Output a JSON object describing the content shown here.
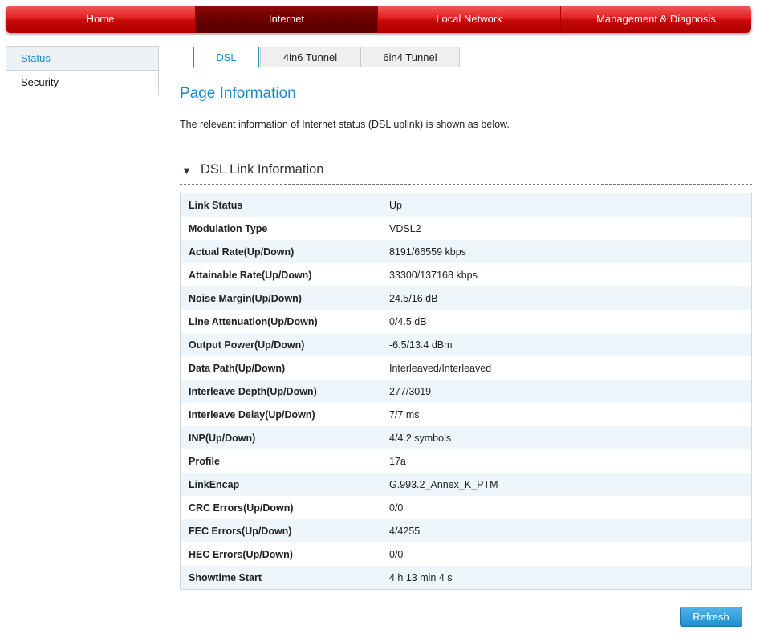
{
  "topnav": {
    "tabs": [
      {
        "label": "Home"
      },
      {
        "label": "Internet"
      },
      {
        "label": "Local Network"
      },
      {
        "label": "Management & Diagnosis"
      }
    ],
    "active": "Internet"
  },
  "sidebar": {
    "items": [
      {
        "label": "Status"
      },
      {
        "label": "Security"
      }
    ],
    "active": "Status"
  },
  "subtabs": {
    "items": [
      {
        "label": "DSL"
      },
      {
        "label": "4in6 Tunnel"
      },
      {
        "label": "6in4 Tunnel"
      }
    ],
    "active": "DSL"
  },
  "page": {
    "title": "Page Information",
    "description": "The relevant information of Internet status (DSL uplink) is shown as below."
  },
  "section": {
    "arrow": "▼",
    "title": "DSL Link Information"
  },
  "rows": [
    {
      "label": "Link Status",
      "value": "Up"
    },
    {
      "label": "Modulation Type",
      "value": "VDSL2"
    },
    {
      "label": "Actual Rate(Up/Down)",
      "value": "8191/66559 kbps"
    },
    {
      "label": "Attainable Rate(Up/Down)",
      "value": "33300/137168 kbps"
    },
    {
      "label": "Noise Margin(Up/Down)",
      "value": "24.5/16 dB"
    },
    {
      "label": "Line Attenuation(Up/Down)",
      "value": "0/4.5 dB"
    },
    {
      "label": "Output Power(Up/Down)",
      "value": "-6.5/13.4 dBm"
    },
    {
      "label": "Data Path(Up/Down)",
      "value": "Interleaved/Interleaved"
    },
    {
      "label": "Interleave Depth(Up/Down)",
      "value": "277/3019"
    },
    {
      "label": "Interleave Delay(Up/Down)",
      "value": "7/7 ms"
    },
    {
      "label": "INP(Up/Down)",
      "value": "4/4.2 symbols"
    },
    {
      "label": "Profile",
      "value": "17a"
    },
    {
      "label": "LinkEncap",
      "value": "G.993.2_Annex_K_PTM"
    },
    {
      "label": "CRC Errors(Up/Down)",
      "value": "0/0"
    },
    {
      "label": "FEC Errors(Up/Down)",
      "value": "4/4255"
    },
    {
      "label": "HEC Errors(Up/Down)",
      "value": "0/0"
    },
    {
      "label": "Showtime Start",
      "value": "4 h 13 min 4 s"
    }
  ],
  "buttons": {
    "refresh": "Refresh"
  },
  "colors": {
    "nav_red": "#e21d1d",
    "nav_active": "#6a0000",
    "accent_blue": "#1a8ac7",
    "row_stripe": "#eef5fb"
  }
}
